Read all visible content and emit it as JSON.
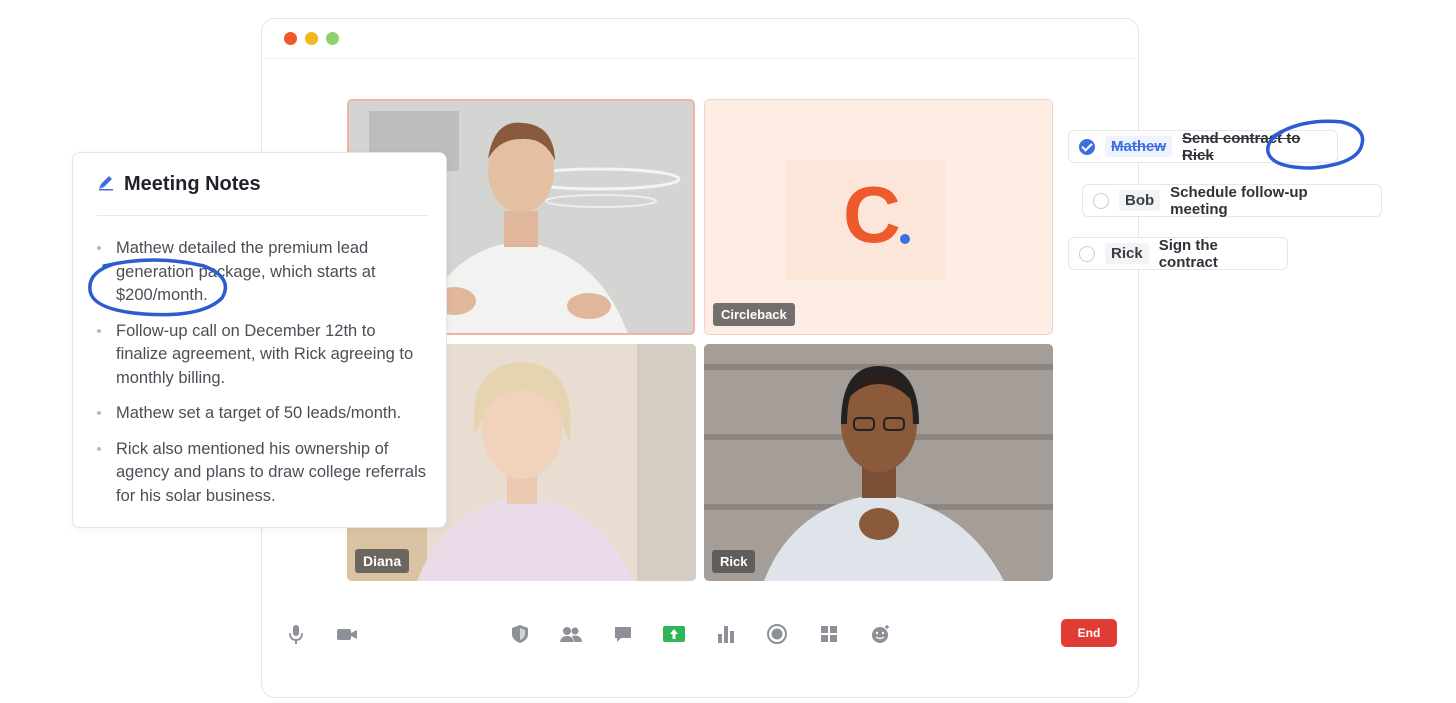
{
  "window": {
    "controls": [
      "close",
      "minimize",
      "maximize"
    ]
  },
  "video_tiles": [
    {
      "label": "",
      "kind": "camera"
    },
    {
      "label": "Circleback",
      "kind": "logo",
      "logo_letter": "C"
    },
    {
      "label": "Diana",
      "kind": "camera"
    },
    {
      "label": "Rick",
      "kind": "camera"
    }
  ],
  "notes": {
    "title": "Meeting Notes",
    "icon": "pencil-icon",
    "items": [
      "Mathew detailed the premium lead generation package, which starts at $200/month.",
      "Follow-up call on December 12th to finalize agreement, with Rick agreeing to monthly billing.",
      "Mathew set a target of 50 leads/month.",
      "Rick also mentioned his ownership of agency and plans to draw college referrals for his solar business."
    ]
  },
  "tasks": [
    {
      "assignee": "Mathew",
      "task": "Send contract to Rick",
      "done": true
    },
    {
      "assignee": "Bob",
      "task": "Schedule follow-up meeting",
      "done": false
    },
    {
      "assignee": "Rick",
      "task": "Sign the contract",
      "done": false
    }
  ],
  "toolbar": {
    "icons": [
      "microphone-icon",
      "video-camera-icon",
      "shield-icon",
      "participants-icon",
      "chat-icon",
      "share-screen-icon",
      "poll-icon",
      "record-icon",
      "apps-grid-icon",
      "reactions-icon"
    ],
    "end_label": "End"
  },
  "colors": {
    "accent": "#3d6fe0",
    "brand": "#ee5a2c",
    "end": "#e03b35",
    "share": "#2fb55a"
  }
}
